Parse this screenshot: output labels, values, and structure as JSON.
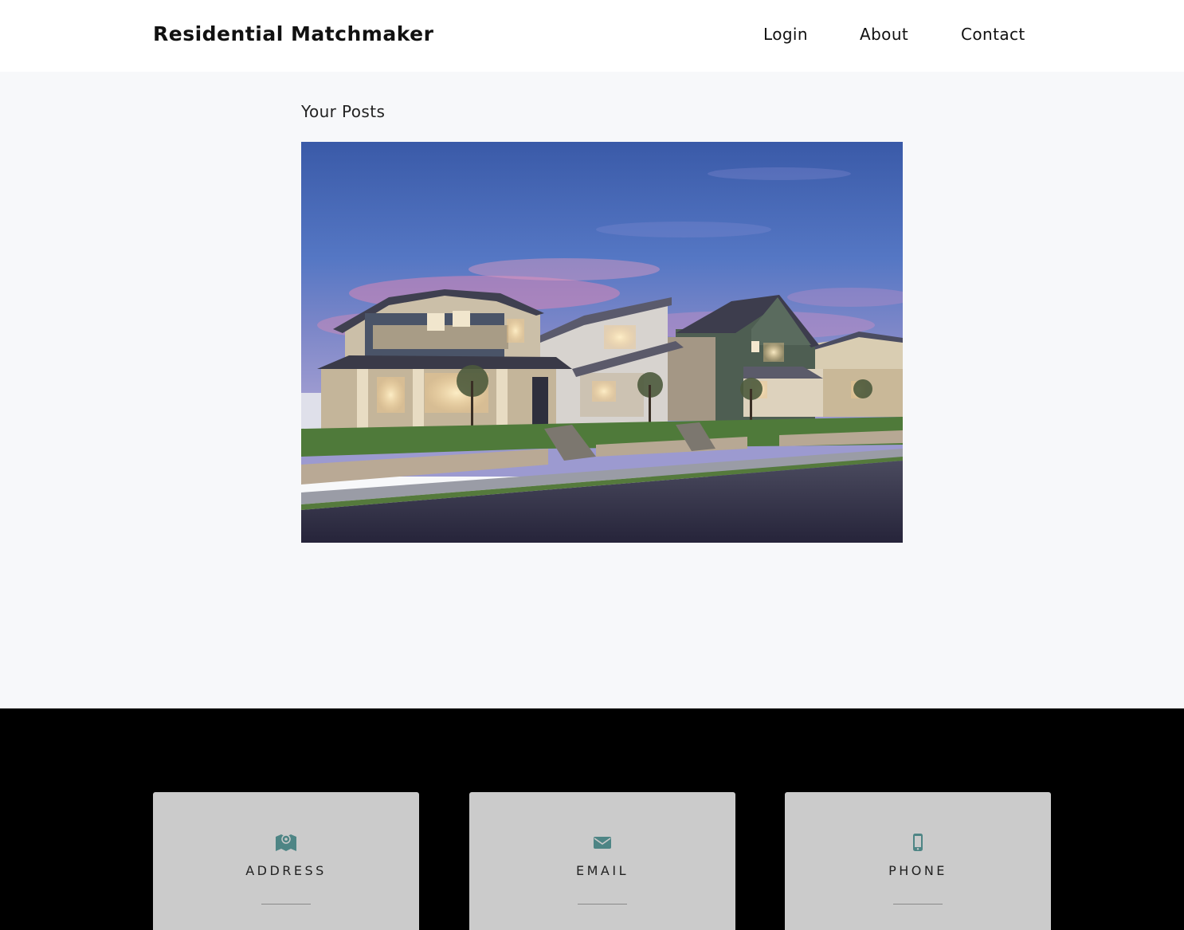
{
  "brand": "Residential Matchmaker",
  "nav": {
    "login": "Login",
    "about": "About",
    "contact": "Contact"
  },
  "main": {
    "heading": "Your Posts",
    "posts": [
      {
        "image_alt": "Row of two-story suburban houses at dusk"
      }
    ]
  },
  "footer": {
    "cards": [
      {
        "title": "ADDRESS",
        "icon": "map-marker-icon"
      },
      {
        "title": "EMAIL",
        "icon": "envelope-icon"
      },
      {
        "title": "PHONE",
        "icon": "mobile-phone-icon"
      }
    ]
  },
  "colors": {
    "accent": "#4e8585",
    "footer_bg": "#000000",
    "card_bg": "#cbcbcb",
    "page_bg": "#f7f8fa"
  }
}
